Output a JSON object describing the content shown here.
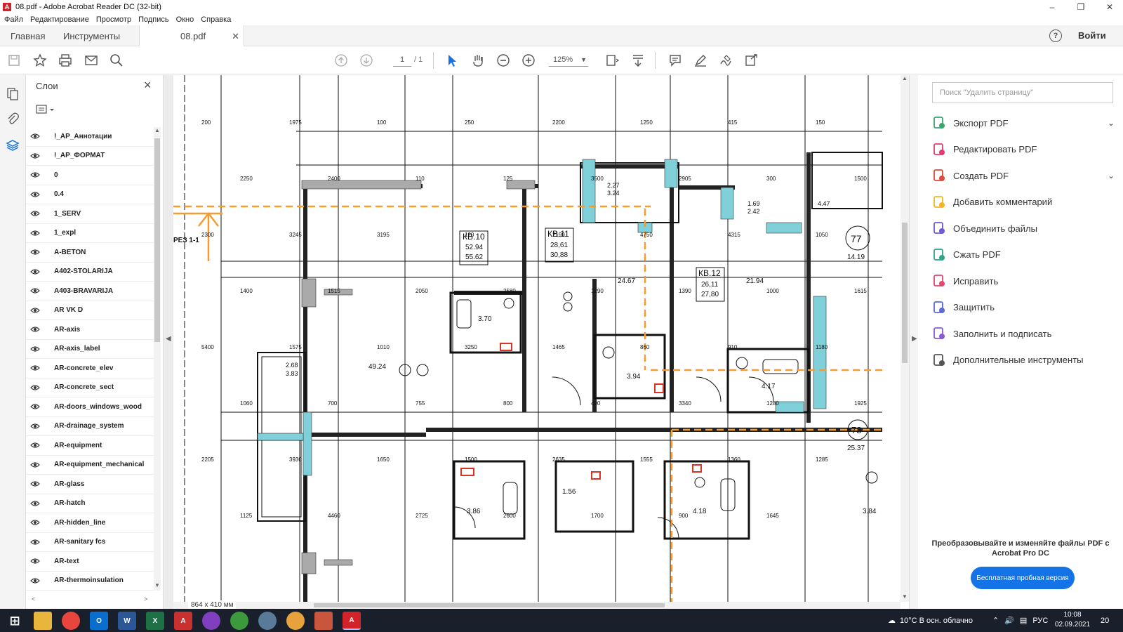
{
  "window": {
    "title": "08.pdf - Adobe Acrobat Reader DC (32-bit)"
  },
  "menu": [
    "Файл",
    "Редактирование",
    "Просмотр",
    "Подпись",
    "Окно",
    "Справка"
  ],
  "tabs": {
    "home": "Главная",
    "tools": "Инструменты",
    "doc": "08.pdf",
    "signin": "Войти"
  },
  "toolbar": {
    "page_current": "1",
    "page_total": "/ 1",
    "zoom": "125%"
  },
  "layers_panel": {
    "title": "Слои",
    "items": [
      "!_AP_Аннотации",
      "!_AP_ФОРМАТ",
      "0",
      "0.4",
      "1_SERV",
      "1_expl",
      "A-BETON",
      "A402-STOLARIJA",
      "A403-BRAVARIJA",
      "AR VK D",
      "AR-axis",
      "AR-axis_label",
      "AR-concrete_elev",
      "AR-concrete_sect",
      "AR-doors_windows_wood",
      "AR-drainage_system",
      "AR-equipment",
      "AR-equipment_mechanical",
      "AR-glass",
      "AR-hatch",
      "AR-hidden_line",
      "AR-sanitary fcs",
      "AR-text",
      "AR-thermoinsulation"
    ]
  },
  "document": {
    "page_size": "864 x 410 мм",
    "section_label": "РЕЗ 1-1",
    "apartments": [
      {
        "name": "КВ.10",
        "a": "52.94",
        "b": "55.62"
      },
      {
        "name": "КВ.11",
        "a": "28,61",
        "b": "30,88"
      },
      {
        "name": "КВ.12",
        "a": "26,11",
        "b": "27,80"
      }
    ],
    "room_areas": [
      "49.24",
      "24.67",
      "21.94",
      "3.70",
      "3.94",
      "4.17",
      "3.86",
      "4.18",
      "1.56",
      "3.84",
      "14.19",
      "25.37",
      "2.68",
      "3.83",
      "2.27",
      "3.24",
      "1.69",
      "2.42",
      "4.47"
    ],
    "room_numbers": [
      "77",
      "78"
    ],
    "dimensions": [
      "200",
      "1975",
      "100",
      "250",
      "2200",
      "1250",
      "415",
      "150",
      "2250",
      "2400",
      "110",
      "125",
      "3500",
      "2905",
      "300",
      "1500",
      "2300",
      "3245",
      "3195",
      "120",
      "2190",
      "4750",
      "4315",
      "1050",
      "1400",
      "1515",
      "2050",
      "2580",
      "1290",
      "1390",
      "1000",
      "1615",
      "5400",
      "1575",
      "1010",
      "3250",
      "1465",
      "860",
      "910",
      "1180",
      "1060",
      "700",
      "755",
      "800",
      "490",
      "3340",
      "1280",
      "1925",
      "2205",
      "3930",
      "1650",
      "1500",
      "2635",
      "1555",
      "1360",
      "1285",
      "1125",
      "4460",
      "2725",
      "2600",
      "1700",
      "900",
      "1645"
    ]
  },
  "tools_panel": {
    "search_placeholder": "Поиск \"Удалить страницу\"",
    "items": [
      {
        "label": "Экспорт PDF",
        "icon": "export-pdf-icon",
        "color": "#3aa76d",
        "chevron": true
      },
      {
        "label": "Редактировать PDF",
        "icon": "edit-pdf-icon",
        "color": "#e03c6e",
        "chevron": false
      },
      {
        "label": "Создать PDF",
        "icon": "create-pdf-icon",
        "color": "#e0483c",
        "chevron": true
      },
      {
        "label": "Добавить комментарий",
        "icon": "comment-icon",
        "color": "#f2b824",
        "chevron": false
      },
      {
        "label": "Объединить файлы",
        "icon": "combine-files-icon",
        "color": "#6c5ad6",
        "chevron": false
      },
      {
        "label": "Сжать PDF",
        "icon": "compress-pdf-icon",
        "color": "#2ea58a",
        "chevron": false
      },
      {
        "label": "Исправить",
        "icon": "redact-icon",
        "color": "#e0486e",
        "chevron": false
      },
      {
        "label": "Защитить",
        "icon": "protect-icon",
        "color": "#5a6ad6",
        "chevron": false
      },
      {
        "label": "Заполнить и подписать",
        "icon": "fill-sign-icon",
        "color": "#8a5ad6",
        "chevron": false
      },
      {
        "label": "Дополнительные инструменты",
        "icon": "more-tools-icon",
        "color": "#555555",
        "chevron": false
      }
    ],
    "promo_text": "Преобразовывайте и изменяйте файлы PDF с Acrobat Pro DC",
    "trial_button": "Бесплатная пробная версия"
  },
  "taskbar": {
    "weather": "10°C  В осн. облачно",
    "lang": "РУС",
    "time": "10:08",
    "date": "02.09.2021",
    "notif": "20"
  },
  "colors": {
    "accent": "#1473e6",
    "section_orange": "#f39c33",
    "insulation_cyan": "#7fd0d8"
  }
}
